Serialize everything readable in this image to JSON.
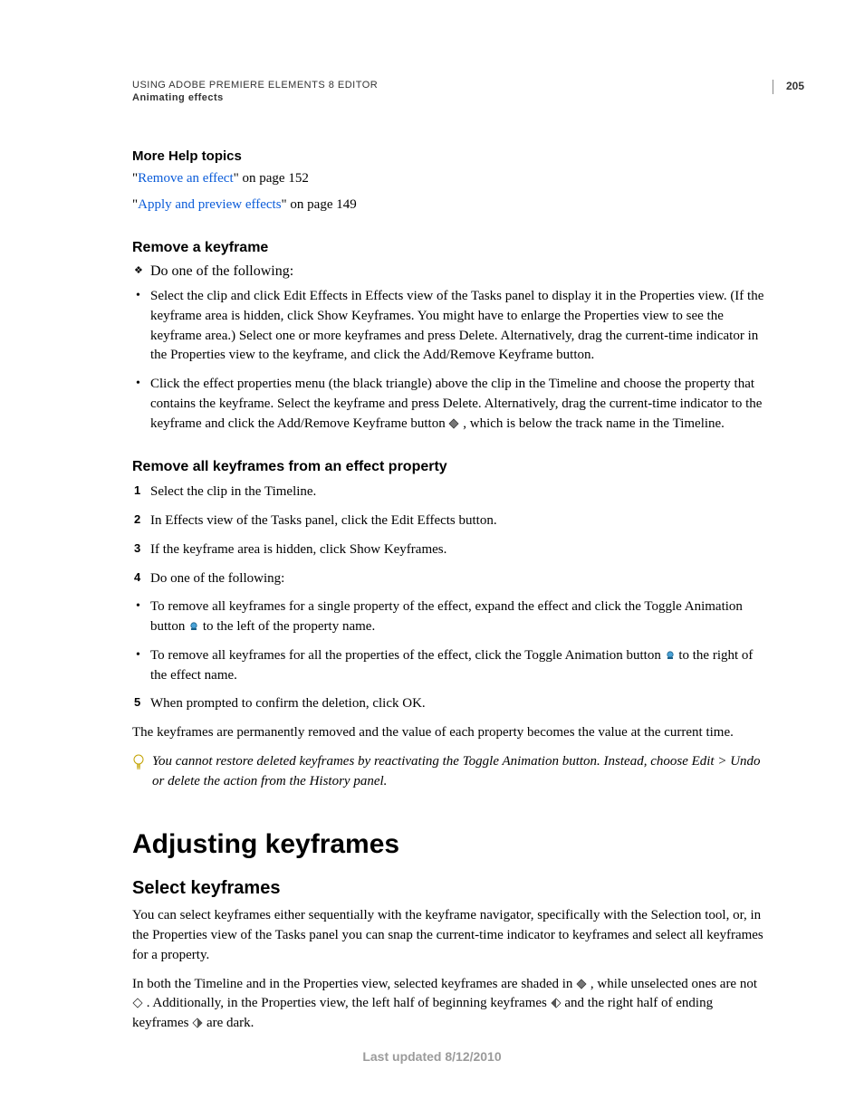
{
  "header": {
    "running_title": "USING ADOBE PREMIERE ELEMENTS 8 EDITOR",
    "section_title": "Animating effects",
    "page_number": "205"
  },
  "morehelp": {
    "heading": "More Help topics",
    "link1_text": "Remove an effect",
    "link1_after": "\" on page 152",
    "link2_text": "Apply and preview effects",
    "link2_after": "\" on page 149"
  },
  "remove_kf": {
    "heading": "Remove a keyframe",
    "intro": "Do one of the following:",
    "b1_before": "Select the clip and click Edit Effects in Effects view of the Tasks panel to display it in the Properties view. (If the keyframe area is hidden, click Show Keyframes. You might have to enlarge the Properties view to see the keyframe area.) Select one or more keyframes and press Delete. Alternatively, drag the current-time indicator in the Properties view to the keyframe, and click the Add/Remove Keyframe button.",
    "b2_before": "Click the effect properties menu (the black triangle) above the clip in the Timeline and choose the property that contains the keyframe. Select the keyframe and press Delete. Alternatively, drag the current-time indicator to the keyframe and click the Add/Remove Keyframe button ",
    "b2_after": ", which is below the track name in the Timeline."
  },
  "remove_all": {
    "heading": "Remove all keyframes from an effect property",
    "s1": "Select the clip in the Timeline.",
    "s2": "In Effects view of the Tasks panel, click the Edit Effects button.",
    "s3": "If the keyframe area is hidden, click Show Keyframes.",
    "s4": "Do one of the following:",
    "sb1_before": "To remove all keyframes for a single property of the effect, expand the effect and click the Toggle Animation button ",
    "sb1_after": " to the left of the property name.",
    "sb2_before": "To remove all keyframes for all the properties of the effect, click the Toggle Animation button ",
    "sb2_after": " to the right of the effect name.",
    "s5": "When prompted to confirm the deletion, click OK.",
    "para_after": "The keyframes are permanently removed and the value of each property becomes the value at the current time.",
    "note": "You cannot restore deleted keyframes by reactivating the Toggle Animation button. Instead, choose Edit > Undo or delete the action from the History panel."
  },
  "adjusting": {
    "chapter": "Adjusting keyframes",
    "topic": "Select keyframes",
    "p1": "You can select keyframes either sequentially with the keyframe navigator, specifically with the Selection tool, or, in the Properties view of the Tasks panel you can snap the current-time indicator to keyframes and select all keyframes for a property.",
    "p2_a": "In both the Timeline and in the Properties view, selected keyframes are shaded in ",
    "p2_b": ", while unselected ones are not ",
    "p2_c": ". Additionally, in the Properties view, the left half of beginning keyframes ",
    "p2_d": " and the right half of ending keyframes ",
    "p2_e": " are dark."
  },
  "footer": {
    "text": "Last updated 8/12/2010"
  }
}
